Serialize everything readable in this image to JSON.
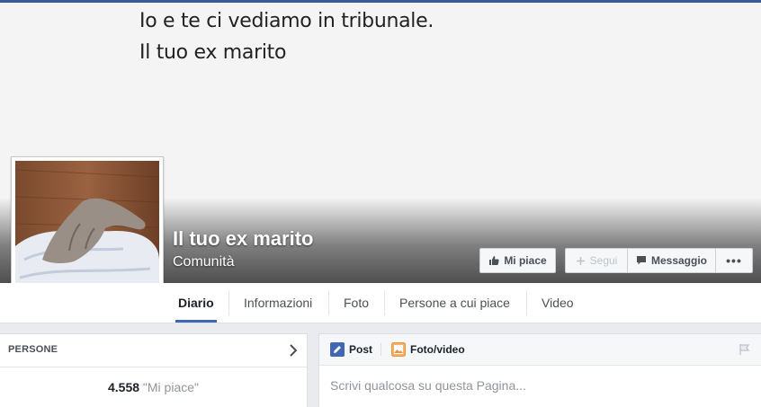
{
  "cover": {
    "line1": "Io e te ci vediamo in tribunale.",
    "line2": "Il tuo ex marito"
  },
  "page": {
    "name": "Il tuo ex marito",
    "category": "Comunità"
  },
  "actions": {
    "like_label": "Mi piace",
    "follow_label": "Segui",
    "message_label": "Messaggio",
    "more_label": "•••"
  },
  "nav": {
    "tabs": [
      {
        "label": "Diario",
        "active": true
      },
      {
        "label": "Informazioni"
      },
      {
        "label": "Foto"
      },
      {
        "label": "Persone a cui piace"
      },
      {
        "label": "Video"
      }
    ]
  },
  "people": {
    "header": "PERSONE",
    "count": "4.558",
    "likes_label": "\"Mi piace\""
  },
  "composer": {
    "post_label": "Post",
    "photo_label": "Foto/video",
    "placeholder": "Scrivi qualcosa su questa Pagina..."
  },
  "colors": {
    "brand": "#3b5998",
    "tab_underline": "#4267b2"
  },
  "icons": [
    "thumbs-up-icon",
    "plus-icon",
    "message-icon",
    "chevron-right-icon",
    "pencil-icon",
    "photo-icon",
    "flag-icon"
  ]
}
